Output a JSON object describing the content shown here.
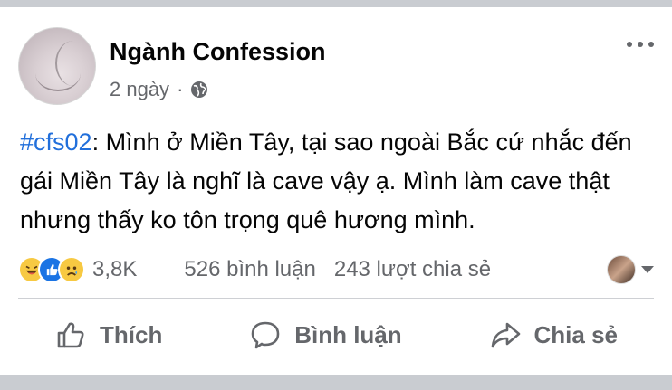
{
  "post": {
    "author": "Ngành Confession",
    "time": "2 ngày",
    "separator": "·",
    "privacy_icon": "globe-icon",
    "hashtag": "#cfs02",
    "body": ": Mình ở Miền Tây, tại sao ngoài Bắc cứ nhắc đến gái Miền Tây là nghĩ là cave vậy ạ. Mình làm cave thật nhưng thấy ko tôn trọng quê hương mình."
  },
  "stats": {
    "reactions": [
      "haha-reaction-icon",
      "like-reaction-icon",
      "sad-reaction-icon"
    ],
    "reaction_count": "3,8K",
    "comments": "526 bình luận",
    "shares": "243 lượt chia sẻ"
  },
  "actions": {
    "like": "Thích",
    "comment": "Bình luận",
    "share": "Chia sẻ"
  },
  "colors": {
    "hashtag": "#216fdb",
    "secondary_text": "#65676b",
    "like_blue": "#1b74e4",
    "reaction_yellow": "#f7c942"
  }
}
